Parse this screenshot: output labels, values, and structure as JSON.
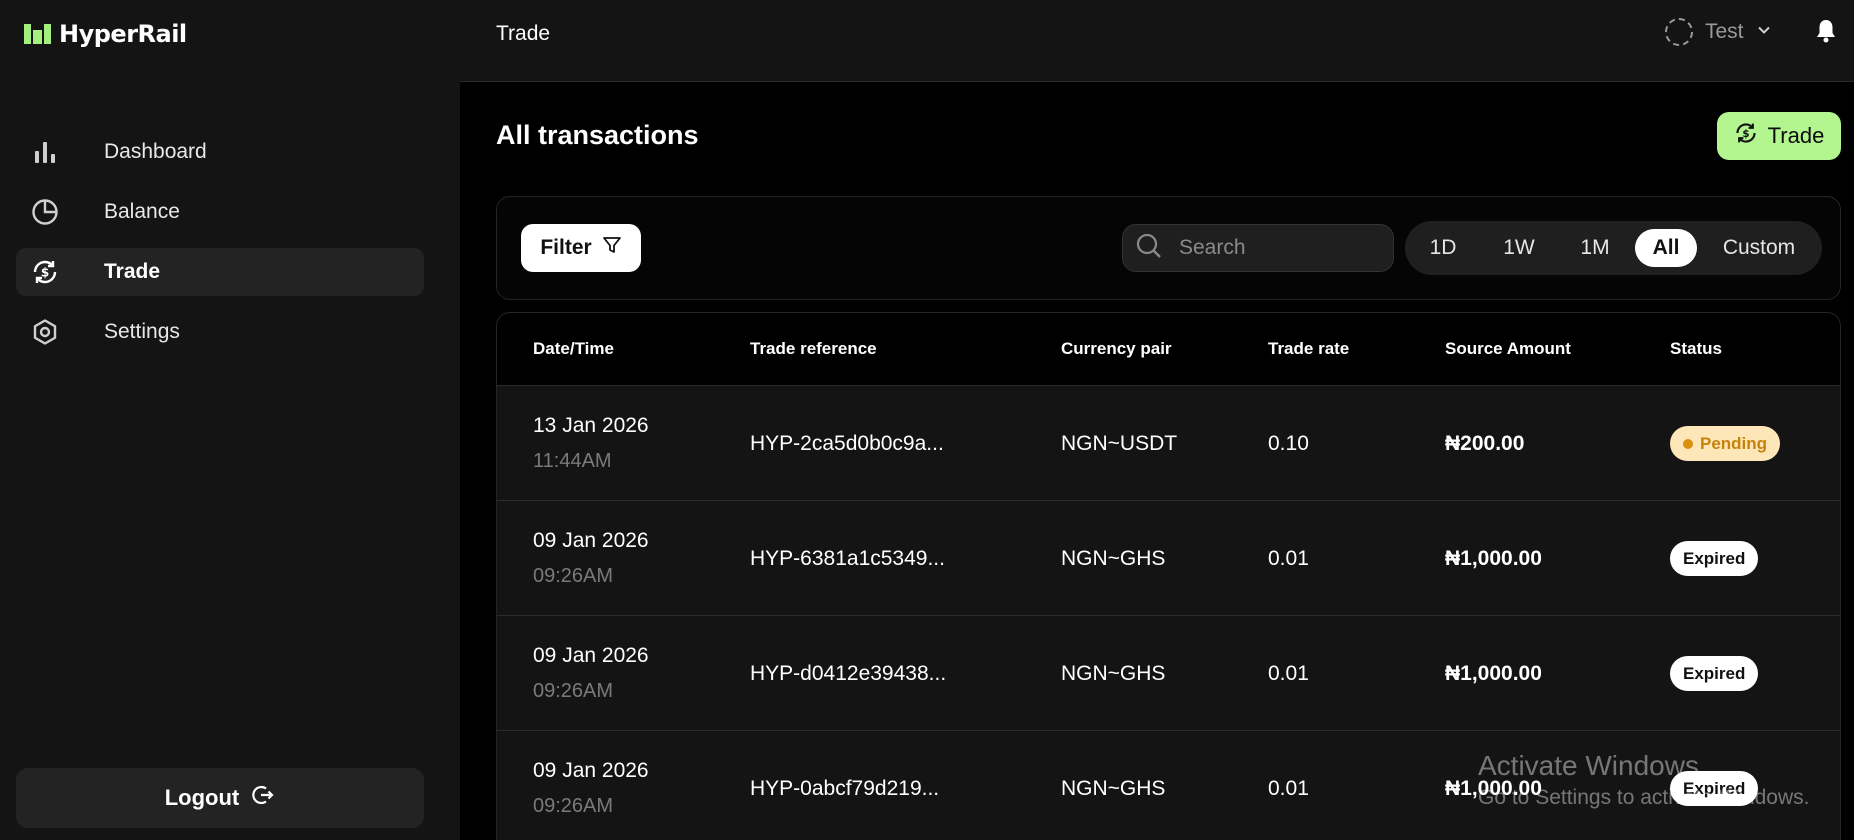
{
  "brand": {
    "name": "HyperRail",
    "accent": "#b3f58f"
  },
  "sidebar": {
    "items": [
      {
        "label": "Dashboard",
        "icon": "bar-chart-icon",
        "active": false
      },
      {
        "label": "Balance",
        "icon": "pie-chart-icon",
        "active": false
      },
      {
        "label": "Trade",
        "icon": "trade-exchange-icon",
        "active": true
      },
      {
        "label": "Settings",
        "icon": "hexagon-settings-icon",
        "active": false
      }
    ],
    "logout_label": "Logout"
  },
  "header": {
    "title": "Trade",
    "user_name": "Test"
  },
  "main": {
    "title": "All transactions",
    "trade_button_label": "Trade",
    "filter_label": "Filter",
    "search": {
      "placeholder": "Search",
      "value": ""
    },
    "ranges": [
      {
        "label": "1D",
        "active": false
      },
      {
        "label": "1W",
        "active": false
      },
      {
        "label": "1M",
        "active": false
      },
      {
        "label": "All",
        "active": true
      },
      {
        "label": "Custom",
        "active": false
      }
    ],
    "table": {
      "columns": [
        "Date/Time",
        "Trade reference",
        "Currency pair",
        "Trade rate",
        "Source Amount",
        "Status"
      ],
      "rows": [
        {
          "date": "13 Jan 2026",
          "time": "11:44AM",
          "reference": "HYP-2ca5d0b0c9a...",
          "pair": "NGN~USDT",
          "rate": "0.10",
          "amount": "₦200.00",
          "status": "Pending"
        },
        {
          "date": "09 Jan 2026",
          "time": "09:26AM",
          "reference": "HYP-6381a1c5349...",
          "pair": "NGN~GHS",
          "rate": "0.01",
          "amount": "₦1,000.00",
          "status": "Expired"
        },
        {
          "date": "09 Jan 2026",
          "time": "09:26AM",
          "reference": "HYP-d0412e39438...",
          "pair": "NGN~GHS",
          "rate": "0.01",
          "amount": "₦1,000.00",
          "status": "Expired"
        },
        {
          "date": "09 Jan 2026",
          "time": "09:26AM",
          "reference": "HYP-0abcf79d219...",
          "pair": "NGN~GHS",
          "rate": "0.01",
          "amount": "₦1,000.00",
          "status": "Expired"
        }
      ]
    }
  },
  "watermark": {
    "line1": "Activate Windows",
    "line2": "Go to Settings to activate Windows."
  }
}
